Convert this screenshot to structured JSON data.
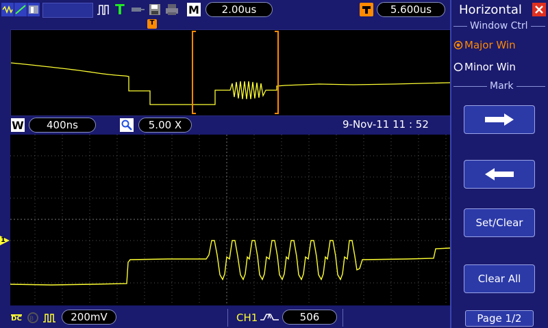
{
  "top_bar": {
    "timebase": "2.00us",
    "trigger_position": "5.600us",
    "menu_title": "Horizontal"
  },
  "mid_bar": {
    "window_timebase": "400ns",
    "zoom_factor": "5.00 X",
    "datetime": "9-Nov-11 11 : 52"
  },
  "bottom_bar": {
    "volts_div": "200mV",
    "trigger_source": "CH1",
    "trigger_level": "506"
  },
  "menu": {
    "window_group_label": "Window Ctrl",
    "option_major": "Major Win",
    "option_minor": "Minor Win",
    "selected_option": "Major Win",
    "mark_group_label": "Mark",
    "set_clear": "Set/Clear",
    "clear_all": "Clear All",
    "page": "Page 1/2"
  },
  "markers": {
    "trigger_marker": "T",
    "channel_marker": "1",
    "mode_letter": "M",
    "window_letter": "W"
  },
  "colors": {
    "background": "#1a1a6e",
    "trace": "#ffff33",
    "accent_orange": "#ff8a00",
    "close_red": "#e03020"
  },
  "icons": [
    "waveform-icon",
    "dots-icon",
    "persist-icon",
    "pulse-icon",
    "trigger-t-icon",
    "probe-icon",
    "save-icon",
    "print-icon",
    "zoom-icon",
    "dc-coupling-icon",
    "bandwidth-icon",
    "invert-icon",
    "rising-edge-icon",
    "close-icon",
    "arrow-right-icon",
    "arrow-left-icon"
  ]
}
